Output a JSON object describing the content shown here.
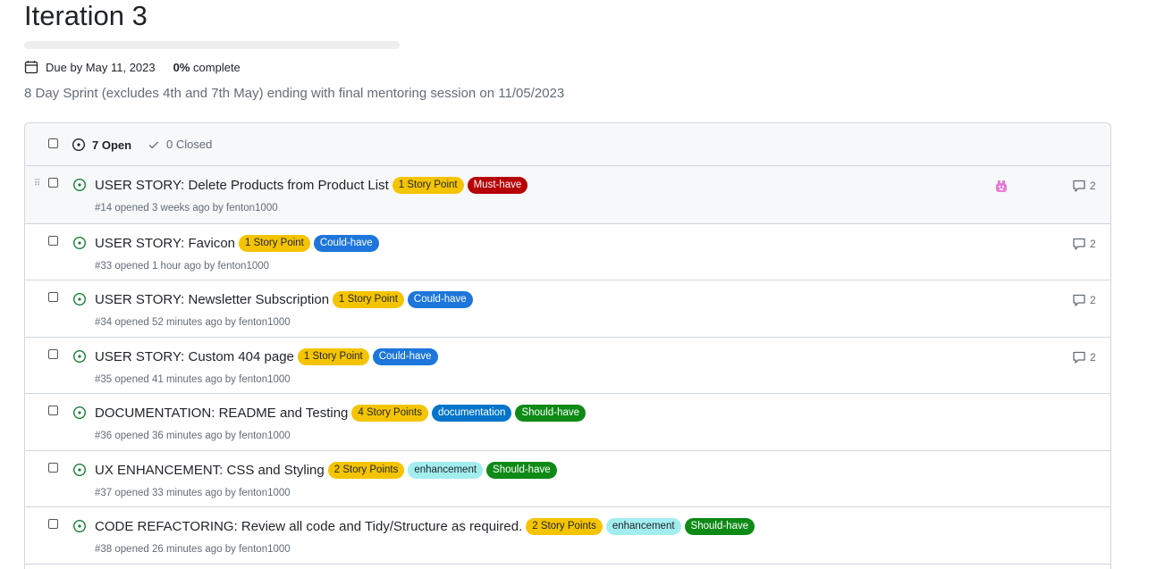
{
  "milestone": {
    "title": "Iteration 3",
    "progress_fraction": 0,
    "due": "Due by May 11, 2023",
    "percent": "0%",
    "percent_suffix": " complete",
    "description": "8 Day Sprint (excludes 4th and 7th May) ending with final mentoring session on 11/05/2023"
  },
  "header": {
    "open": "7 Open",
    "closed": "0 Closed"
  },
  "colors": {
    "story_point": "#f5c400",
    "must_have": "#b60205",
    "could_have": "#1d76db",
    "documentation": "#0075ca",
    "should_have": "#0e8a16",
    "enhancement": "#a2eeef",
    "open_icon": "#1a7f37"
  },
  "issues": [
    {
      "title": "USER STORY: Delete Products from Product List",
      "meta": "#14 opened 3 weeks ago by fenton1000",
      "comments": "2",
      "assignee_avatar": "pink-identicon",
      "labels": [
        {
          "text": "1 Story Point",
          "bg": "#f5c400",
          "fg": "#1f2328"
        },
        {
          "text": "Must-have",
          "bg": "#b60205",
          "fg": "#ffffff"
        }
      ]
    },
    {
      "title": "USER STORY: Favicon",
      "meta": "#33 opened 1 hour ago by fenton1000",
      "comments": "2",
      "labels": [
        {
          "text": "1 Story Point",
          "bg": "#f5c400",
          "fg": "#1f2328"
        },
        {
          "text": "Could-have",
          "bg": "#1d76db",
          "fg": "#ffffff"
        }
      ]
    },
    {
      "title": "USER STORY: Newsletter Subscription",
      "meta": "#34 opened 52 minutes ago by fenton1000",
      "comments": "2",
      "labels": [
        {
          "text": "1 Story Point",
          "bg": "#f5c400",
          "fg": "#1f2328"
        },
        {
          "text": "Could-have",
          "bg": "#1d76db",
          "fg": "#ffffff"
        }
      ]
    },
    {
      "title": "USER STORY: Custom 404 page",
      "meta": "#35 opened 41 minutes ago by fenton1000",
      "comments": "2",
      "labels": [
        {
          "text": "1 Story Point",
          "bg": "#f5c400",
          "fg": "#1f2328"
        },
        {
          "text": "Could-have",
          "bg": "#1d76db",
          "fg": "#ffffff"
        }
      ]
    },
    {
      "title": "DOCUMENTATION: README and Testing",
      "meta": "#36 opened 36 minutes ago by fenton1000",
      "comments": "",
      "labels": [
        {
          "text": "4 Story Points",
          "bg": "#f5c400",
          "fg": "#1f2328"
        },
        {
          "text": "documentation",
          "bg": "#0075ca",
          "fg": "#ffffff"
        },
        {
          "text": "Should-have",
          "bg": "#0e8a16",
          "fg": "#ffffff"
        }
      ]
    },
    {
      "title": "UX ENHANCEMENT: CSS and Styling",
      "meta": "#37 opened 33 minutes ago by fenton1000",
      "comments": "",
      "labels": [
        {
          "text": "2 Story Points",
          "bg": "#f5c400",
          "fg": "#1f2328"
        },
        {
          "text": "enhancement",
          "bg": "#a2eeef",
          "fg": "#1f2328"
        },
        {
          "text": "Should-have",
          "bg": "#0e8a16",
          "fg": "#ffffff"
        }
      ]
    },
    {
      "title": "CODE REFACTORING: Review all code and Tidy/Structure as required.",
      "meta": "#38 opened 26 minutes ago by fenton1000",
      "comments": "",
      "labels": [
        {
          "text": "2 Story Points",
          "bg": "#f5c400",
          "fg": "#1f2328"
        },
        {
          "text": "enhancement",
          "bg": "#a2eeef",
          "fg": "#1f2328"
        },
        {
          "text": "Should-have",
          "bg": "#0e8a16",
          "fg": "#ffffff"
        }
      ]
    }
  ]
}
